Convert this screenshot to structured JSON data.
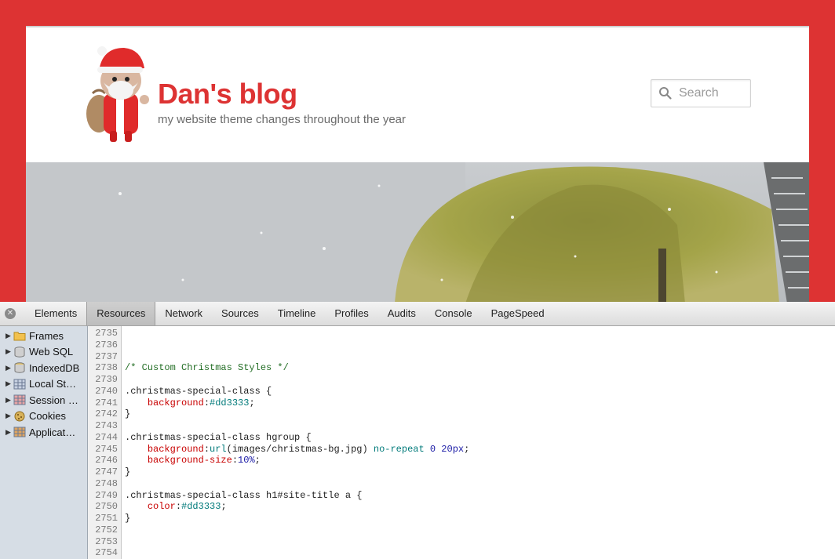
{
  "site": {
    "title": "Dan's blog",
    "description": "my website theme changes throughout the year",
    "search_placeholder": "Search",
    "accent_color": "#dd3333"
  },
  "devtools": {
    "tabs": [
      "Elements",
      "Resources",
      "Network",
      "Sources",
      "Timeline",
      "Profiles",
      "Audits",
      "Console",
      "PageSpeed"
    ],
    "active_tab": "Resources",
    "sidebar": [
      {
        "label": "Frames",
        "icon": "folder-icon"
      },
      {
        "label": "Web SQL",
        "icon": "database-icon"
      },
      {
        "label": "IndexedDB",
        "icon": "database-icon"
      },
      {
        "label": "Local St…",
        "icon": "grid-icon"
      },
      {
        "label": "Session …",
        "icon": "grid-icon"
      },
      {
        "label": "Cookies",
        "icon": "cookie-icon"
      },
      {
        "label": "Applicat…",
        "icon": "grid-icon"
      }
    ],
    "line_numbers": [
      "2735",
      "2736",
      "2737",
      "2738",
      "2739",
      "2740",
      "2741",
      "2742",
      "2743",
      "2744",
      "2745",
      "2746",
      "2747",
      "2748",
      "2749",
      "2750",
      "2751",
      "2752",
      "2753",
      "2754"
    ],
    "code_lines": [
      [],
      [],
      [],
      [
        {
          "t": "/* Custom Christmas Styles */",
          "c": "c-comment"
        }
      ],
      [],
      [
        {
          "t": ".christmas-special-class {",
          "c": ""
        }
      ],
      [
        {
          "t": "    ",
          "c": ""
        },
        {
          "t": "background",
          "c": "c-prop"
        },
        {
          "t": ":",
          "c": ""
        },
        {
          "t": "#dd3333",
          "c": "c-teal"
        },
        {
          "t": ";",
          "c": ""
        }
      ],
      [
        {
          "t": "}",
          "c": ""
        }
      ],
      [],
      [
        {
          "t": ".christmas-special-class hgroup {",
          "c": ""
        }
      ],
      [
        {
          "t": "    ",
          "c": ""
        },
        {
          "t": "background",
          "c": "c-prop"
        },
        {
          "t": ":",
          "c": ""
        },
        {
          "t": "url",
          "c": "c-teal"
        },
        {
          "t": "(images/christmas-bg.jpg) ",
          "c": ""
        },
        {
          "t": "no-repeat",
          "c": "c-teal"
        },
        {
          "t": " ",
          "c": ""
        },
        {
          "t": "0",
          "c": "c-val"
        },
        {
          "t": " ",
          "c": ""
        },
        {
          "t": "20px",
          "c": "c-val"
        },
        {
          "t": ";",
          "c": ""
        }
      ],
      [
        {
          "t": "    ",
          "c": ""
        },
        {
          "t": "background-size",
          "c": "c-prop"
        },
        {
          "t": ":",
          "c": ""
        },
        {
          "t": "10%",
          "c": "c-val"
        },
        {
          "t": ";",
          "c": ""
        }
      ],
      [
        {
          "t": "}",
          "c": ""
        }
      ],
      [],
      [
        {
          "t": ".christmas-special-class h1#site-title a {",
          "c": ""
        }
      ],
      [
        {
          "t": "    ",
          "c": ""
        },
        {
          "t": "color",
          "c": "c-prop"
        },
        {
          "t": ":",
          "c": ""
        },
        {
          "t": "#dd3333",
          "c": "c-teal"
        },
        {
          "t": ";",
          "c": ""
        }
      ],
      [
        {
          "t": "}",
          "c": ""
        }
      ],
      [],
      [],
      []
    ]
  }
}
